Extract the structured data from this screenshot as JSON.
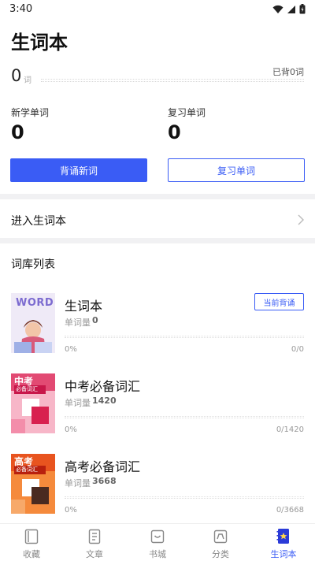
{
  "status_bar": {
    "time": "3:40"
  },
  "page": {
    "title": "生词本"
  },
  "summary": {
    "count": "0",
    "unit": "词",
    "learned": "已背0词"
  },
  "stats": {
    "new_words": {
      "label": "新学单词",
      "value": "0"
    },
    "review_words": {
      "label": "复习单词",
      "value": "0"
    }
  },
  "actions": {
    "recite_new": "背诵新词",
    "review": "复习单词"
  },
  "entry": {
    "label": "进入生词本"
  },
  "library": {
    "title": "词库列表",
    "count_label": "单词量",
    "books": [
      {
        "name": "生词本",
        "count": "0",
        "percent": "0%",
        "ratio": "0/0",
        "current_label": "当前背诵",
        "cover_text": "WORD"
      },
      {
        "name": "中考必备词汇",
        "count": "1420",
        "percent": "0%",
        "ratio": "0/1420",
        "cover_title": "中考",
        "cover_sub": "必备词汇"
      },
      {
        "name": "高考必备词汇",
        "count": "3668",
        "percent": "0%",
        "ratio": "0/3668",
        "cover_title": "高考",
        "cover_sub": "必备词汇"
      }
    ]
  },
  "nav": [
    {
      "label": "收藏",
      "icon": "bookmark-icon"
    },
    {
      "label": "文章",
      "icon": "article-icon"
    },
    {
      "label": "书城",
      "icon": "store-icon"
    },
    {
      "label": "分类",
      "icon": "category-icon"
    },
    {
      "label": "生词本",
      "icon": "vocab-book-icon",
      "active": true
    }
  ],
  "colors": {
    "accent": "#3a5cf5",
    "divider": "#f1f1f3"
  }
}
